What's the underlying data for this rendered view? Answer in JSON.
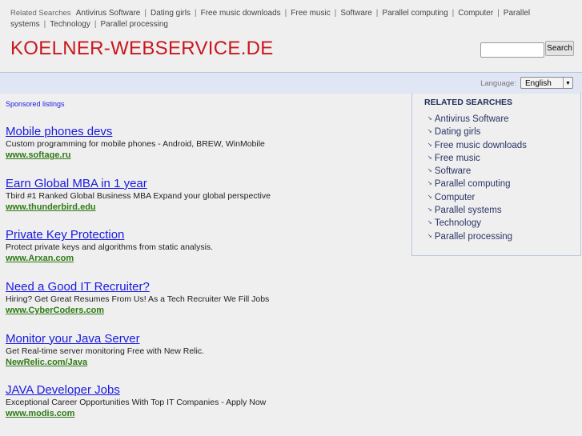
{
  "top": {
    "label": "Related Searches",
    "links": [
      "Antivirus Software",
      "Dating girls",
      "Free music downloads",
      "Free music",
      "Software",
      "Parallel computing",
      "Computer",
      "Parallel systems",
      "Technology",
      "Parallel processing"
    ]
  },
  "site_title": "KOELNER-WEBSERVICE.DE",
  "search": {
    "value": "",
    "button": "Search"
  },
  "language": {
    "label": "Language:",
    "selected": "English"
  },
  "sponsored_label": "Sponsored listings",
  "ads": [
    {
      "title": "Mobile phones devs",
      "desc": "Custom programming for mobile phones - Android, BREW, WinMobile",
      "url": "www.softage.ru"
    },
    {
      "title": "Earn Global MBA in 1 year",
      "desc": "Tbird #1 Ranked Global Business MBA Expand your global perspective",
      "url": "www.thunderbird.edu"
    },
    {
      "title": "Private Key Protection",
      "desc": "Protect private keys and algorithms from static analysis.",
      "url": "www.Arxan.com"
    },
    {
      "title": "Need a Good IT Recruiter?",
      "desc": "Hiring? Get Great Resumes From Us! As a Tech Recruiter We Fill Jobs",
      "url": "www.CyberCoders.com"
    },
    {
      "title": "Monitor your Java Server",
      "desc": "Get Real-time server monitoring Free with New Relic.",
      "url": "NewRelic.com/Java"
    },
    {
      "title": "JAVA Developer Jobs",
      "desc": "Exceptional Career Opportunities With Top IT Companies - Apply Now",
      "url": "www.modis.com"
    }
  ],
  "related": {
    "heading": "RELATED SEARCHES",
    "items": [
      "Antivirus Software",
      "Dating girls",
      "Free music downloads",
      "Free music",
      "Software",
      "Parallel computing",
      "Computer",
      "Parallel systems",
      "Technology",
      "Parallel processing"
    ]
  }
}
